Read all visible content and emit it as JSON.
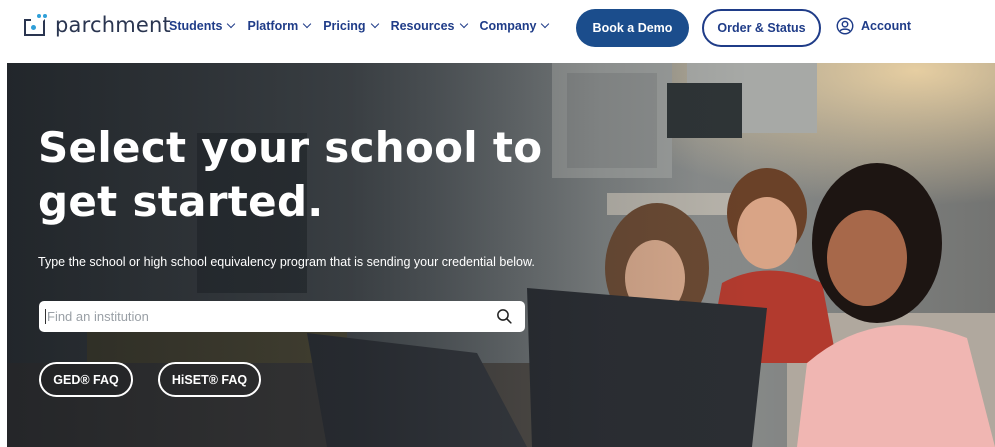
{
  "header": {
    "logo_text": "parchment",
    "logo_tm": "·",
    "nav": [
      {
        "label": "Students"
      },
      {
        "label": "Platform"
      },
      {
        "label": "Pricing"
      },
      {
        "label": "Resources"
      },
      {
        "label": "Company"
      }
    ],
    "book_demo_label": "Book a Demo",
    "order_status_label": "Order & Status",
    "account_label": "Account"
  },
  "hero": {
    "title_line1": "Select your school to",
    "title_line2": "get started.",
    "subtitle": "Type the school or high school equivalency program that is sending your credential below.",
    "search_placeholder": "Find an institution",
    "faq_buttons": [
      {
        "label": "GED® FAQ"
      },
      {
        "label": "HiSET® FAQ"
      }
    ]
  },
  "colors": {
    "brand_blue": "#1b4d8c",
    "nav_blue": "#1f3c88",
    "logo_accent": "#2f9fd8"
  },
  "icons": [
    "logo-mark-icon",
    "chevron-down-icon",
    "account-icon",
    "search-icon"
  ]
}
